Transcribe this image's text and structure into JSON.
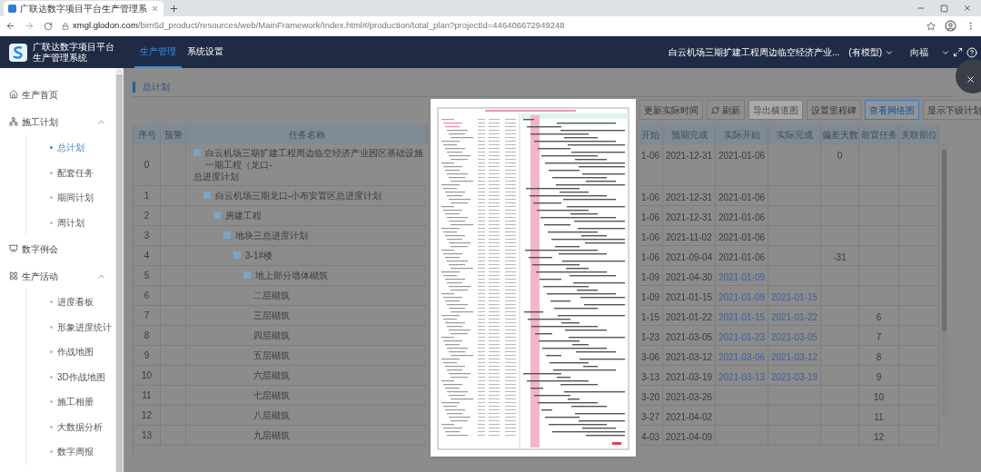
{
  "browser": {
    "tab_title": "广联达数字项目平台生产管理系",
    "url_host": "xmgl.glodon.com",
    "url_path": "/bim5d_product/resources/web/MainFramework/Index.html#/production/total_plan?projectId=446406672949248"
  },
  "header": {
    "product_name": [
      "广联达数字项目平台",
      "生产管理系统"
    ],
    "nav": [
      {
        "label": "生产管理",
        "selected": true
      },
      {
        "label": "系统设置",
        "selected": false
      }
    ],
    "project": "白云机场三期扩建工程周边临空经济产业...",
    "model_tag": "(有模型)",
    "user": "向福"
  },
  "sidebar": [
    {
      "label": "生产首页"
    },
    {
      "label": "施工计划",
      "expanded": true,
      "children": [
        {
          "label": "总计划",
          "selected": true
        },
        {
          "label": "配套任务",
          "selected": false
        },
        {
          "label": "期间计划",
          "selected": false
        },
        {
          "label": "周计划",
          "selected": false
        }
      ]
    },
    {
      "label": "数字例会"
    },
    {
      "label": "生产活动",
      "expanded": true,
      "children": [
        {
          "label": "进度看板",
          "selected": false
        },
        {
          "label": "形象进度统计",
          "selected": false
        },
        {
          "label": "作战地图",
          "selected": false
        },
        {
          "label": "3D作战地图",
          "selected": false
        },
        {
          "label": "施工相册",
          "selected": false
        },
        {
          "label": "大数据分析",
          "selected": false
        },
        {
          "label": "数字周报",
          "selected": false
        }
      ]
    }
  ],
  "panel": {
    "title": "总计划",
    "toolbar": [
      {
        "label": "更新实际时间",
        "kind": "text",
        "disabled": false,
        "selected": false
      },
      {
        "label": "刷新",
        "kind": "refresh",
        "disabled": false,
        "selected": false
      },
      {
        "label": "导出横道图",
        "kind": "text",
        "disabled": true,
        "selected": false
      },
      {
        "label": "设置里程碑",
        "kind": "text",
        "disabled": false,
        "selected": false
      },
      {
        "label": "查看网络图",
        "kind": "text",
        "disabled": false,
        "selected": true
      },
      {
        "label": "显示下级计划",
        "kind": "text",
        "disabled": false,
        "selected": false
      }
    ],
    "table": {
      "columns_left": [
        "序号",
        "预警",
        "任务名称"
      ],
      "columns_right": [
        "开始",
        "预期完成",
        "实际开始",
        "实际完成",
        "偏差天数",
        "前置任务",
        "关联部位"
      ],
      "tasks": [
        {
          "no": "0",
          "name": "白云机场三期扩建工程周边临空经济产业园区基础设施一期工程（龙口-",
          "name_more": "总进度计划",
          "start": "1-06",
          "plan_end": "2021-12-31",
          "actual_start": "2021-01-06",
          "deviation": "0",
          "actual_reported": false,
          "children": [
            {
              "no": "1",
              "name": "白云机场三期龙口-小布安置区总进度计划",
              "start": "1-06",
              "plan_end": "2021-12-31",
              "actual_start": "2021-01-06",
              "actual_reported": false,
              "children": [
                {
                  "no": "2",
                  "name": "房建工程",
                  "start": "1-06",
                  "plan_end": "2021-12-31",
                  "actual_start": "2021-01-06",
                  "actual_reported": false,
                  "children": [
                    {
                      "no": "3",
                      "name": "地块三总进度计划",
                      "start": "1-06",
                      "plan_end": "2021-11-02",
                      "actual_start": "2021-01-06",
                      "actual_reported": false,
                      "children": [
                        {
                          "no": "4",
                          "name": "3-1#楼",
                          "start": "1-06",
                          "plan_end": "2021-09-04",
                          "actual_start": "2021-01-06",
                          "deviation": "-31",
                          "actual_reported": false,
                          "children": [
                            {
                              "no": "5",
                              "name": "地上部分墙体砌筑",
                              "start": "1-09",
                              "plan_end": "2021-04-30",
                              "actual_start": "2021-01-09",
                              "actual_reported": true,
                              "children": [
                                {
                                  "no": "6",
                                  "name": "二层砌筑",
                                  "start": "1-09",
                                  "plan_end": "2021-01-15",
                                  "actual_start": "2021-01-09",
                                  "actual_end": "2021-01-15",
                                  "actual_reported": true
                                },
                                {
                                  "no": "7",
                                  "name": "三层砌筑",
                                  "start": "1-15",
                                  "plan_end": "2021-01-22",
                                  "actual_start": "2021-01-15",
                                  "actual_end": "2021-01-22",
                                  "predecessor": "6",
                                  "actual_reported": true
                                },
                                {
                                  "no": "8",
                                  "name": "四层砌筑",
                                  "start": "1-23",
                                  "plan_end": "2021-03-05",
                                  "actual_start": "2021-01-23",
                                  "actual_end": "2021-03-05",
                                  "predecessor": "7",
                                  "actual_reported": true
                                },
                                {
                                  "no": "9",
                                  "name": "五层砌筑",
                                  "start": "3-06",
                                  "plan_end": "2021-03-12",
                                  "actual_start": "2021-03-06",
                                  "actual_end": "2021-03-12",
                                  "predecessor": "8",
                                  "actual_reported": true
                                },
                                {
                                  "no": "10",
                                  "name": "六层砌筑",
                                  "start": "3-13",
                                  "plan_end": "2021-03-19",
                                  "actual_start": "2021-03-13",
                                  "actual_end": "2021-03-19",
                                  "predecessor": "9",
                                  "actual_reported": true
                                },
                                {
                                  "no": "11",
                                  "name": "七层砌筑",
                                  "start": "3-20",
                                  "plan_end": "2021-03-26",
                                  "predecessor": "10"
                                },
                                {
                                  "no": "12",
                                  "name": "八层砌筑",
                                  "start": "3-27",
                                  "plan_end": "2021-04-02",
                                  "predecessor": "11"
                                },
                                {
                                  "no": "13",
                                  "name": "九层砌筑",
                                  "start": "4-03",
                                  "plan_end": "2021-04-09",
                                  "predecessor": "12"
                                }
                              ]
                            }
                          ]
                        }
                      ]
                    }
                  ]
                }
              ]
            }
          ]
        }
      ]
    }
  }
}
